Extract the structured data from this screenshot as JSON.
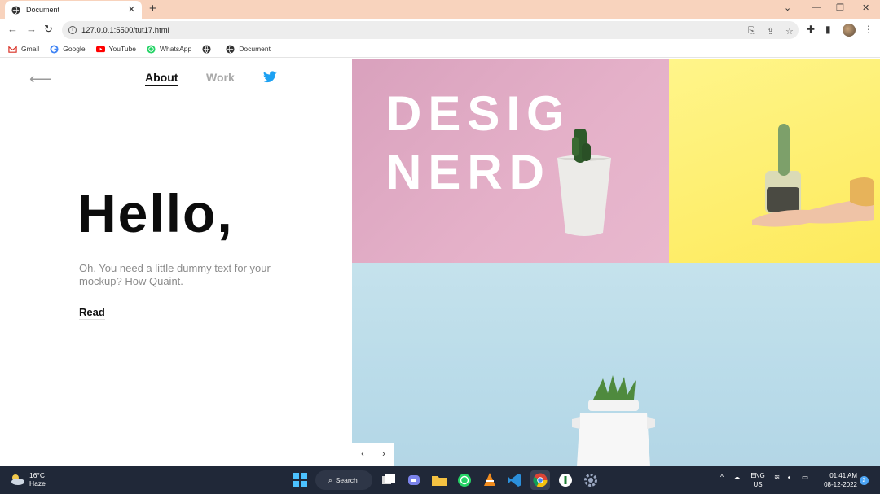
{
  "browser": {
    "tab_title": "Document",
    "url": "127.0.0.1:5500/tut17.html",
    "bookmarks": [
      "Gmail",
      "Google",
      "YouTube",
      "WhatsApp",
      "",
      "Document"
    ]
  },
  "page": {
    "nav": {
      "about": "About",
      "work": "Work"
    },
    "hero": {
      "title": "Hello,",
      "description": "Oh, You need a little dummy text for your mockup? How Quaint.",
      "read_link": "Read"
    },
    "slide_text": {
      "line1": "DESIG",
      "line2": "NERD"
    },
    "slider_prev": "‹",
    "slider_next": "›"
  },
  "taskbar": {
    "weather_temp": "16°C",
    "weather_desc": "Haze",
    "search_label": "Search",
    "lang_line1": "ENG",
    "lang_line2": "US",
    "time": "01:41 AM",
    "date": "08-12-2022",
    "notification_count": "2"
  },
  "colors": {
    "pink_panel": "#e5b1c9",
    "yellow_panel": "#fdea5c",
    "blue_panel": "#b9dbe9",
    "twitter_blue": "#1da1f2",
    "tabbar": "#f8d3bd",
    "taskbar": "#202838"
  }
}
